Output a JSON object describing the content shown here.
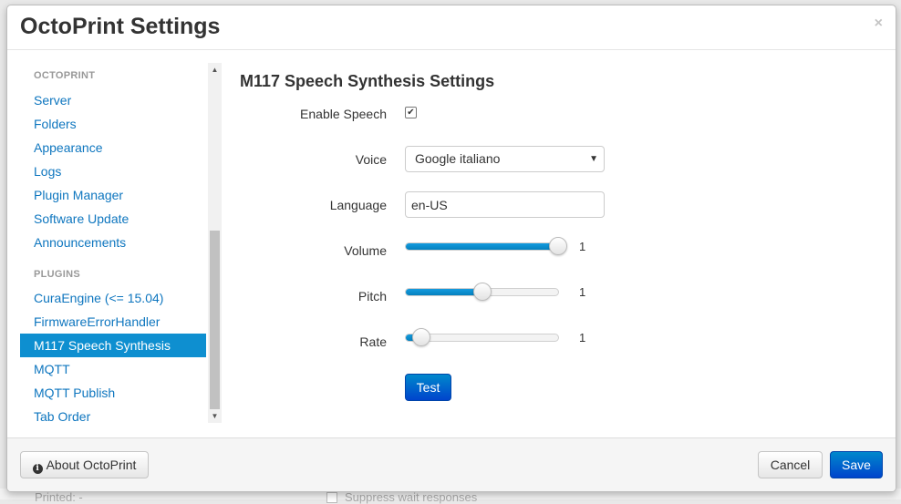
{
  "background": {
    "left_text": "Printed: -",
    "right_text": "Suppress wait responses"
  },
  "modal": {
    "title": "OctoPrint Settings",
    "close_icon": "×"
  },
  "sidebar": {
    "groups": [
      {
        "header": "OCTOPRINT",
        "items": [
          "Server",
          "Folders",
          "Appearance",
          "Logs",
          "Plugin Manager",
          "Software Update",
          "Announcements"
        ]
      },
      {
        "header": "PLUGINS",
        "items": [
          "CuraEngine (<= 15.04)",
          "FirmwareErrorHandler",
          "M117 Speech Synthesis",
          "MQTT",
          "MQTT Publish",
          "Tab Order"
        ]
      }
    ],
    "active_item": "M117 Speech Synthesis",
    "scroll_up": "▲",
    "scroll_down": "▼"
  },
  "content": {
    "section_title": "M117 Speech Synthesis Settings",
    "enable_speech": {
      "label": "Enable Speech",
      "checked": true,
      "check_glyph": "✔"
    },
    "voice": {
      "label": "Voice",
      "value": "Google italiano",
      "arrow": "▼"
    },
    "language": {
      "label": "Language",
      "value": "en-US"
    },
    "volume": {
      "label": "Volume",
      "value": "1",
      "level": 1.0
    },
    "pitch": {
      "label": "Pitch",
      "value": "1",
      "level": 0.5
    },
    "rate": {
      "label": "Rate",
      "value": "1",
      "level": 0.1
    },
    "test_button": "Test"
  },
  "footer": {
    "about_button": "About OctoPrint",
    "info_glyph": "i",
    "cancel_button": "Cancel",
    "save_button": "Save"
  },
  "colors": {
    "link": "#0e76bf",
    "active_bg": "#0e8fd0",
    "primary": "#0044cc"
  }
}
